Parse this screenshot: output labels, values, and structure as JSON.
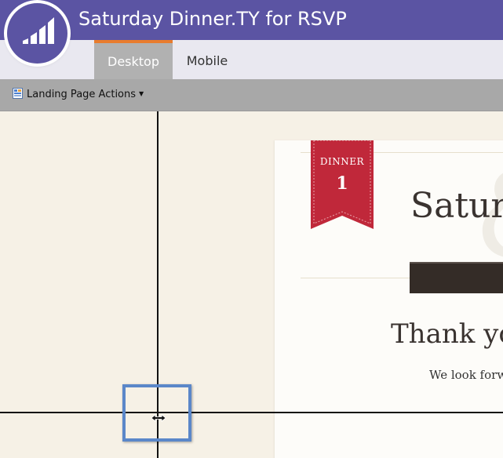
{
  "header": {
    "title": "Saturday Dinner.TY for RSVP",
    "logo_icon": "marketo-logo-icon",
    "background_color": "#5b54a3"
  },
  "tabs": [
    {
      "label": "Desktop",
      "active": true
    },
    {
      "label": "Mobile",
      "active": false
    }
  ],
  "toolbar": {
    "actions_label": "Landing Page Actions",
    "actions_icon": "page-icon",
    "dropdown_icon": "caret-down-icon"
  },
  "landing_page": {
    "ribbon_label": "DINNER",
    "ribbon_number": "1",
    "heading": "Satur",
    "watermark_glyph": "&",
    "thank_you": "Thank yo",
    "look_forward": "We look forw",
    "ribbon_color": "#c0283a"
  },
  "editor": {
    "guide_color": "#111111",
    "handle_color": "#5b87c9",
    "cursor_icon": "resize-horizontal-cursor-icon"
  }
}
